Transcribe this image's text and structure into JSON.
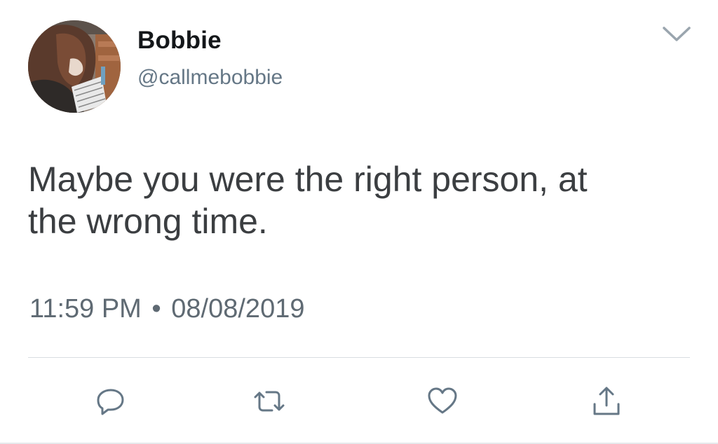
{
  "user": {
    "display_name": "Bobbie",
    "handle": "@callmebobbie"
  },
  "tweet": {
    "text_line1": "Maybe you were the right person, at",
    "text_line2": "the wrong time.",
    "time": "11:59 PM",
    "separator": "•",
    "date": "08/08/2019"
  },
  "actions": [
    {
      "name": "reply",
      "icon": "reply-icon"
    },
    {
      "name": "retweet",
      "icon": "retweet-icon"
    },
    {
      "name": "like",
      "icon": "heart-icon"
    },
    {
      "name": "share",
      "icon": "share-icon"
    }
  ],
  "colors": {
    "icon": "#657786",
    "text": "#3b3e41",
    "divider": "#d9dde1"
  }
}
